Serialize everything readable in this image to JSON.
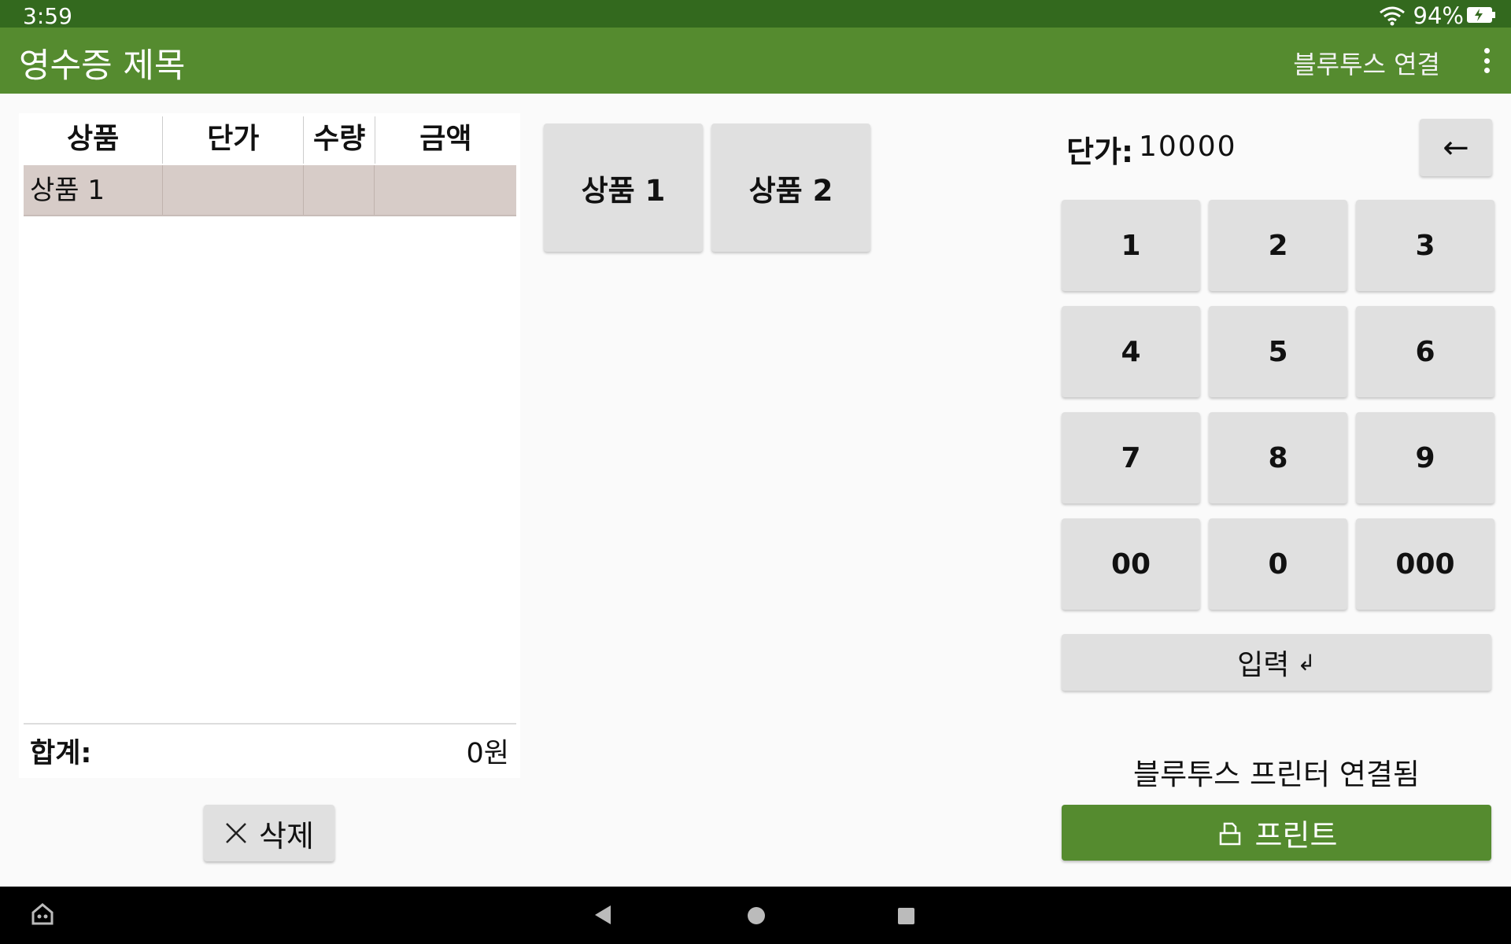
{
  "status_bar": {
    "time": "3:59",
    "battery": "94%"
  },
  "app_bar": {
    "title": "영수증 제목",
    "bluetooth_connect": "블루투스 연결"
  },
  "receipt_table": {
    "headers": [
      "상품",
      "단가",
      "수량",
      "금액"
    ],
    "rows": [
      {
        "name": "상품 1",
        "price": "",
        "qty": "",
        "amount": ""
      }
    ],
    "total_label": "합계:",
    "total_value": "0원"
  },
  "delete_button": {
    "label": "삭제"
  },
  "products": [
    "상품 1",
    "상품 2"
  ],
  "keypad": {
    "price_label": "단가:",
    "price_value": "10000",
    "backspace": "←",
    "keys": [
      "1",
      "2",
      "3",
      "4",
      "5",
      "6",
      "7",
      "8",
      "9",
      "00",
      "0",
      "000"
    ],
    "enter_label": "입력",
    "enter_symbol": "↲"
  },
  "printer_status": "블루투스 프린터 연결됨",
  "print_button": {
    "label": "프린트"
  },
  "colors": {
    "status_bar": "#33691e",
    "app_bar": "#558b2f",
    "selected_row": "#d7ccc8",
    "button": "#e0e0e0"
  }
}
